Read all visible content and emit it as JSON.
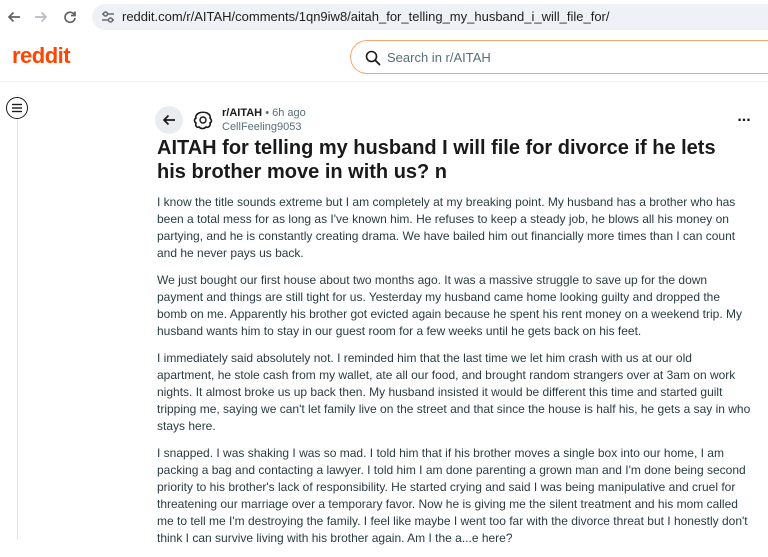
{
  "browser": {
    "back_icon": "arrow-left-icon",
    "forward_icon": "arrow-right-icon",
    "reload_icon": "reload-icon",
    "site_info_icon": "tune-icon",
    "url": "reddit.com/r/AITAH/comments/1qn9iw8/aitah_for_telling_my_husband_i_will_file_for/"
  },
  "header": {
    "logo": "reddit",
    "search_placeholder": "Search in r/AITAH",
    "search_value": ""
  },
  "post": {
    "subreddit": "r/AITAH",
    "separator": "•",
    "age": "6h ago",
    "author": "CellFeeling9053",
    "title": "AITAH for telling my husband I will file for divorce if he lets his brother move in with us? n",
    "paragraphs": [
      "I know the title sounds extreme but I am completely at my breaking point. My husband has a brother who has been a total mess for as long as I've known him. He refuses to keep a steady job, he blows all his money on partying, and he is constantly creating drama. We have bailed him out financially more times than I can count and he never pays us back.",
      "We just bought our first house about two months ago. It was a massive struggle to save up for the down payment and things are still tight for us. Yesterday my husband came home looking guilty and dropped the bomb on me. Apparently his brother got evicted again because he spent his rent money on a weekend trip. My husband wants him to stay in our guest room for a few weeks until he gets back on his feet.",
      "I immediately said absolutely not. I reminded him that the last time we let him crash with us at our old apartment, he stole cash from my wallet, ate all our food, and brought random strangers over at 3am on work nights. It almost broke us up back then. My husband insisted it would be different this time and started guilt tripping me, saying we can't let family live on the street and that since the house is half his, he gets a say in who stays here.",
      "I snapped. I was shaking I was so mad. I told him that if his brother moves a single box into our home, I am packing a bag and contacting a lawyer. I told him I am done parenting a grown man and I'm done being second priority to his brother's lack of responsibility. He started crying and said I was being manipulative and cruel for threatening our marriage over a temporary favor. Now he is giving me the silent treatment and his mom called me to tell me I'm destroying the family. I feel like maybe I went too far with the divorce threat but I honestly don't think I can survive living with his brother again. Am I the a...e here?"
    ],
    "more_label": "..."
  }
}
